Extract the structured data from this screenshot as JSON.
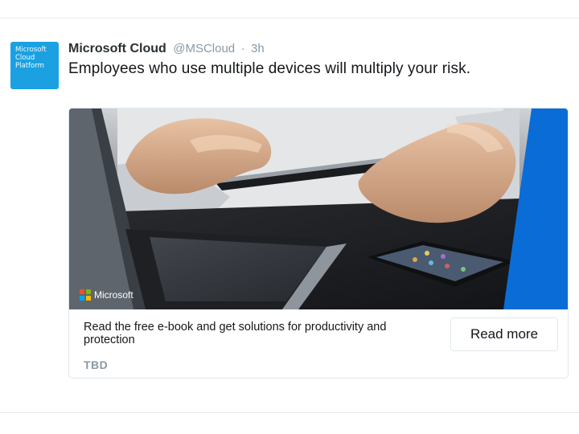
{
  "tweet": {
    "avatar_text": [
      "Microsoft",
      "Cloud",
      "Platform"
    ],
    "display_name": "Microsoft Cloud",
    "handle": "@MSCloud",
    "separator": "·",
    "time": "3h",
    "text": "Employees who use multiple devices will multiply your risk."
  },
  "card": {
    "logo_text": "Microsoft",
    "description": "Read the free e-book and get solutions for productivity and protection",
    "domain": "TBD",
    "button_label": "Read more"
  },
  "colors": {
    "avatar_bg": "#1ba1e2",
    "accent_blue": "#0a6cd6",
    "ms_red": "#f25022",
    "ms_green": "#7fba00",
    "ms_blue": "#00a4ef",
    "ms_yellow": "#ffb900"
  }
}
